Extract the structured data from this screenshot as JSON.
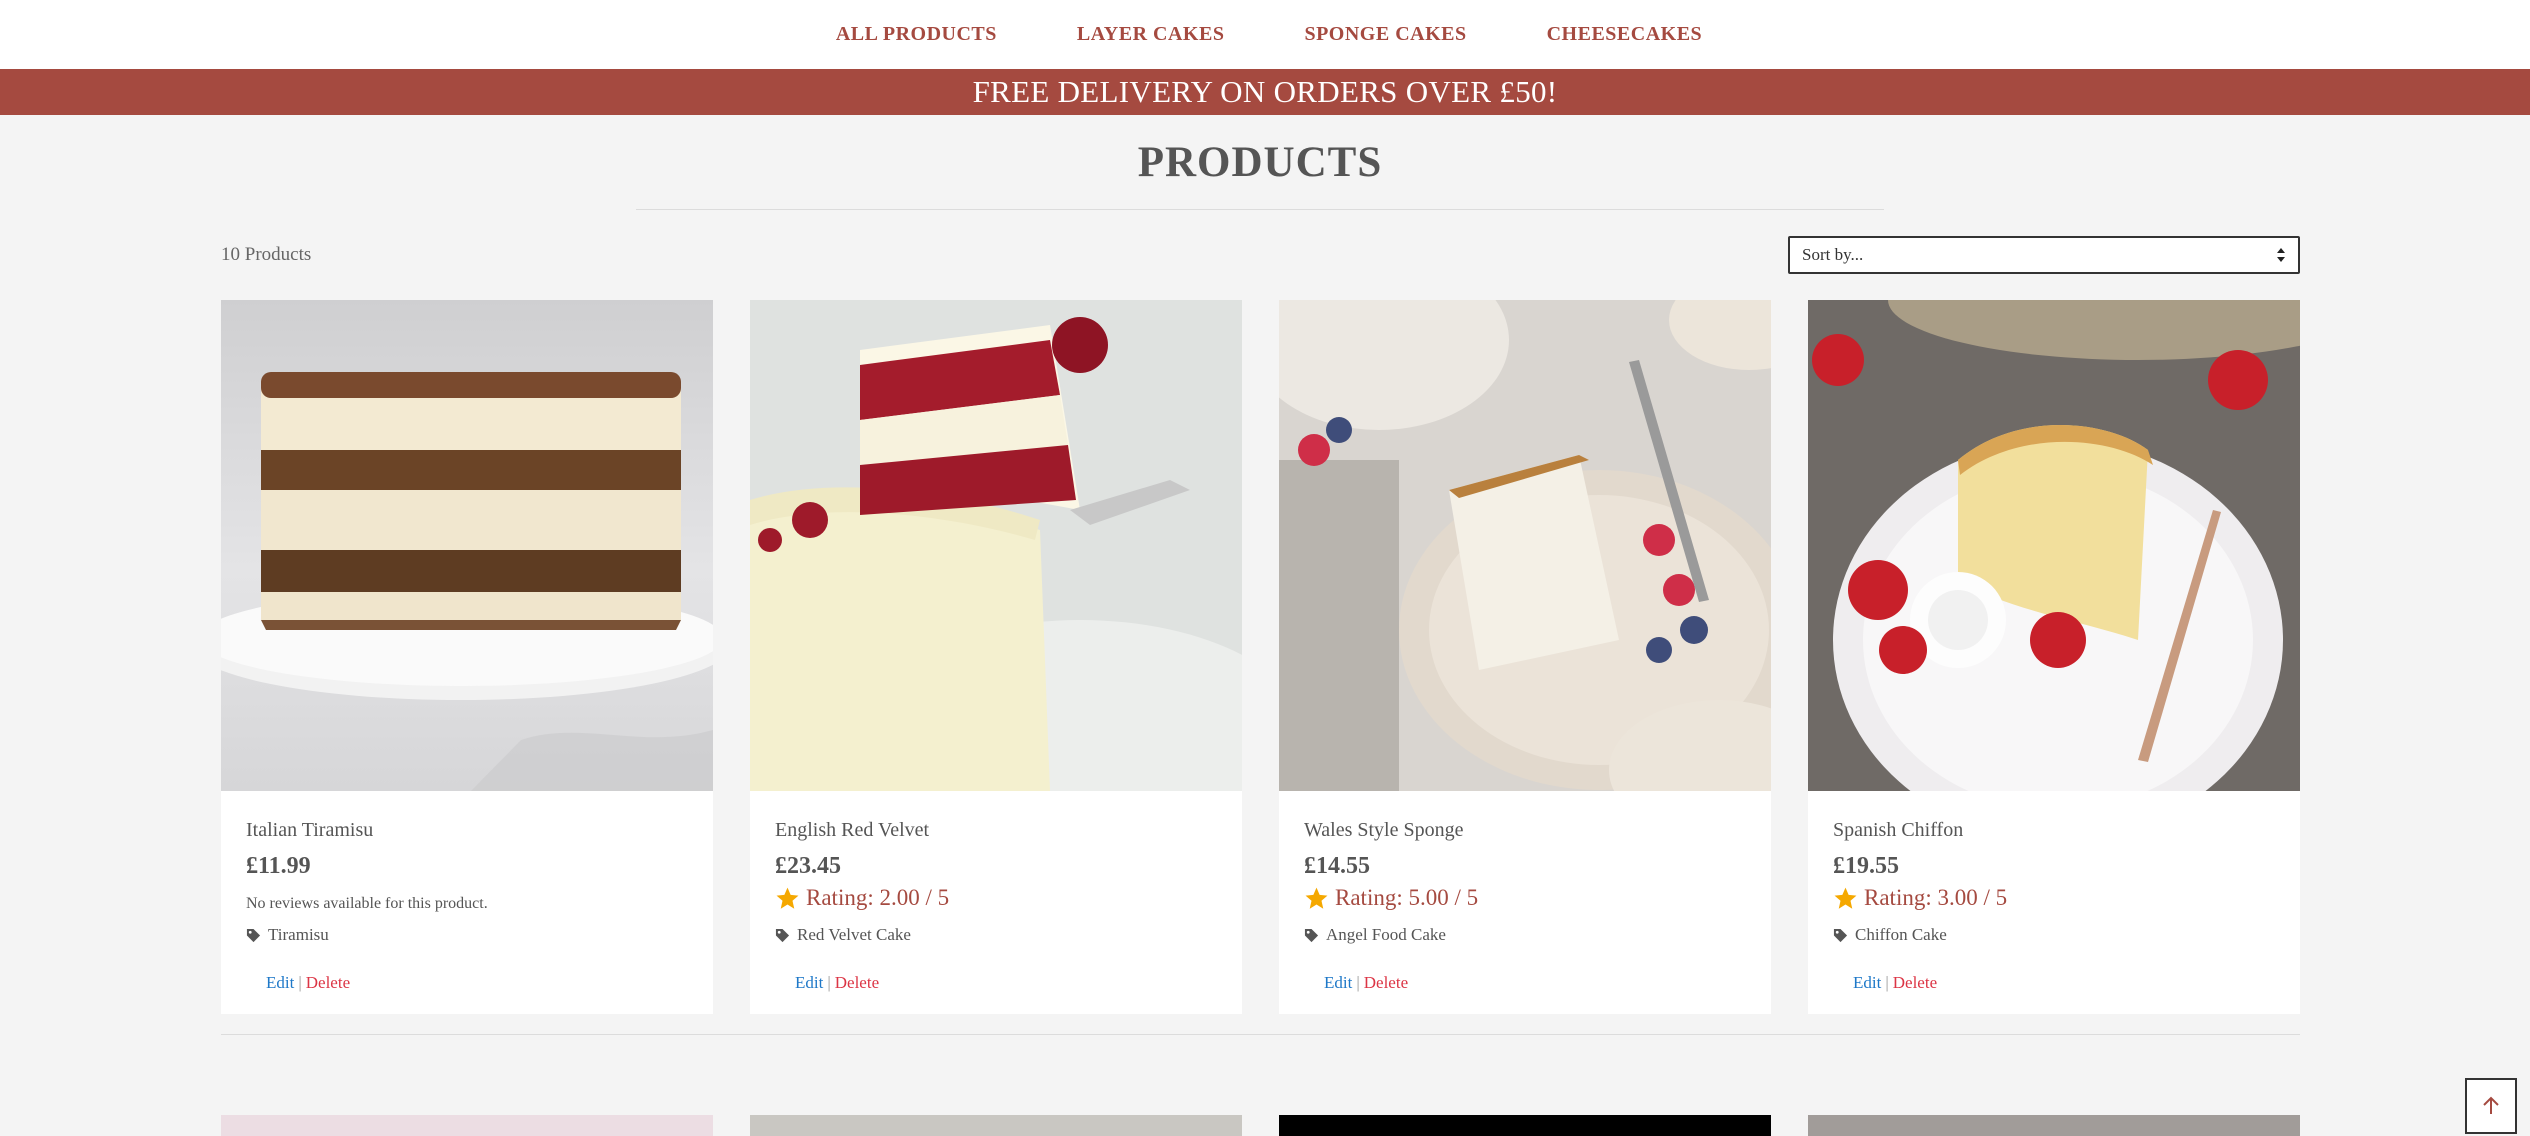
{
  "nav": {
    "items": [
      "ALL PRODUCTS",
      "LAYER CAKES",
      "SPONGE CAKES",
      "CHEESECAKES"
    ]
  },
  "banner": {
    "text": "FREE DELIVERY ON ORDERS OVER £50!"
  },
  "page": {
    "title": "PRODUCTS",
    "count": "10 Products",
    "sort_placeholder": "Sort by..."
  },
  "products": [
    {
      "name": "Italian Tiramisu",
      "price": "£11.99",
      "review_text": "No reviews available for this product.",
      "rating_text": "",
      "tag": "Tiramisu"
    },
    {
      "name": "English Red Velvet",
      "price": "£23.45",
      "review_text": "",
      "rating_text": "Rating: 2.00 / 5",
      "rating": 2.0,
      "tag": "Red Velvet Cake"
    },
    {
      "name": "Wales Style Sponge",
      "price": "£14.55",
      "review_text": "",
      "rating_text": "Rating: 5.00 / 5",
      "rating": 5.0,
      "tag": "Angel Food Cake"
    },
    {
      "name": "Spanish Chiffon",
      "price": "£19.55",
      "review_text": "",
      "rating_text": "Rating: 3.00 / 5",
      "rating": 3.0,
      "tag": "Chiffon Cake"
    }
  ],
  "actions": {
    "edit": "Edit",
    "separator": "|",
    "delete": "Delete"
  },
  "colors": {
    "brand": "#a54a40",
    "star": "#f5a800",
    "edit_link": "#1e78c8",
    "delete_link": "#dc3545"
  },
  "icons": {
    "tag": "tag-icon",
    "star": "star-icon",
    "scroll_top": "arrow-up-icon",
    "sort": "sort-arrows-icon"
  }
}
